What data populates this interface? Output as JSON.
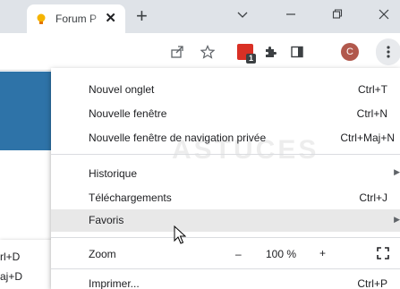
{
  "tab": {
    "title": "Forum P",
    "close": "✕"
  },
  "newtab": "+",
  "window_controls": {
    "dropdown": "⌄",
    "minimize": "—",
    "restore": "⧉",
    "close": "✕"
  },
  "toolbar": {
    "extension_badge": "1",
    "avatar_letter": "C"
  },
  "watermark": "ASTUCES",
  "submenu": {
    "shortcut1": "rl+D",
    "shortcut2": "aj+D"
  },
  "menu": {
    "group1": [
      {
        "label": "Nouvel onglet",
        "shortcut": "Ctrl+T"
      },
      {
        "label": "Nouvelle fenêtre",
        "shortcut": "Ctrl+N"
      },
      {
        "label": "Nouvelle fenêtre de navigation privée",
        "shortcut": "Ctrl+Maj+N"
      }
    ],
    "group2": [
      {
        "label": "Historique",
        "shortcut": ""
      },
      {
        "label": "Téléchargements",
        "shortcut": "Ctrl+J"
      },
      {
        "label": "Favoris",
        "shortcut": ""
      }
    ],
    "zoom": {
      "label": "Zoom",
      "minus": "–",
      "value": "100 %",
      "plus": "+"
    },
    "print": {
      "label": "Imprimer...",
      "shortcut": "Ctrl+P"
    }
  },
  "colors": {
    "accent": "#2e73a8",
    "titlebar": "#dfe3e8",
    "highlight": "#e8e8e8",
    "extension_red": "#d93025",
    "avatar": "#b1584c"
  }
}
